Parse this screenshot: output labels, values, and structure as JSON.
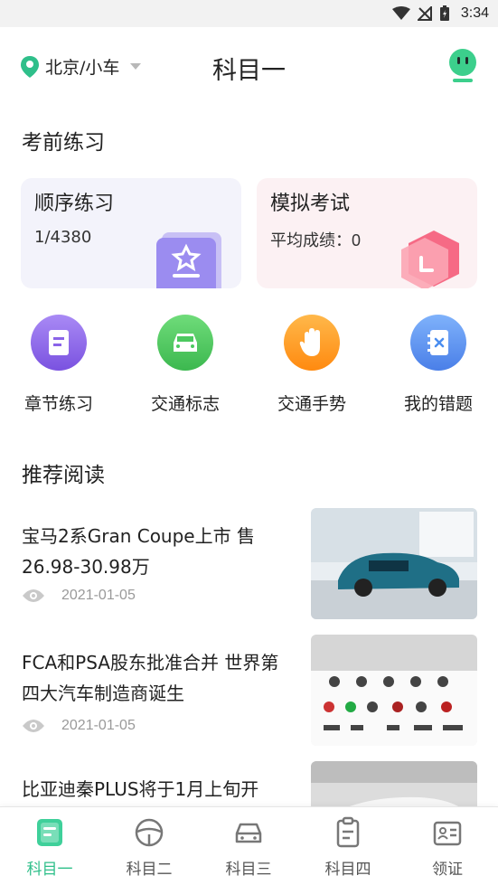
{
  "status_bar": {
    "time": "3:34"
  },
  "header": {
    "location": "北京/小车",
    "title": "科目一"
  },
  "practice_section": {
    "title": "考前练习"
  },
  "cards": {
    "sequential": {
      "title": "顺序练习",
      "progress": "1/4380"
    },
    "mock_exam": {
      "title": "模拟考试",
      "score_label": "平均成绩：",
      "score_value": "0"
    }
  },
  "shortcuts": [
    {
      "label": "章节练习",
      "icon": "document-icon",
      "color": "#8a63e8"
    },
    {
      "label": "交通标志",
      "icon": "car-icon",
      "color": "#4cc95f"
    },
    {
      "label": "交通手势",
      "icon": "hand-icon",
      "color": "#ff9a1f"
    },
    {
      "label": "我的错题",
      "icon": "notebook-icon",
      "color": "#4a8df0"
    }
  ],
  "reading_section": {
    "title": "推荐阅读"
  },
  "articles": [
    {
      "title": "宝马2系Gran Coupe上市 售26.98-30.98万",
      "date": "2021-01-05"
    },
    {
      "title": "FCA和PSA股东批准合并 世界第四大汽车制造商诞生",
      "date": "2021-01-05"
    },
    {
      "title": "比亚迪秦PLUS将于1月上旬开"
    }
  ],
  "bottom_nav": [
    {
      "label": "科目一",
      "active": true
    },
    {
      "label": "科目二",
      "active": false
    },
    {
      "label": "科目三",
      "active": false
    },
    {
      "label": "科目四",
      "active": false
    },
    {
      "label": "领证",
      "active": false
    }
  ],
  "colors": {
    "accent": "#2fbf8a",
    "underline": "#4fd3a5"
  }
}
